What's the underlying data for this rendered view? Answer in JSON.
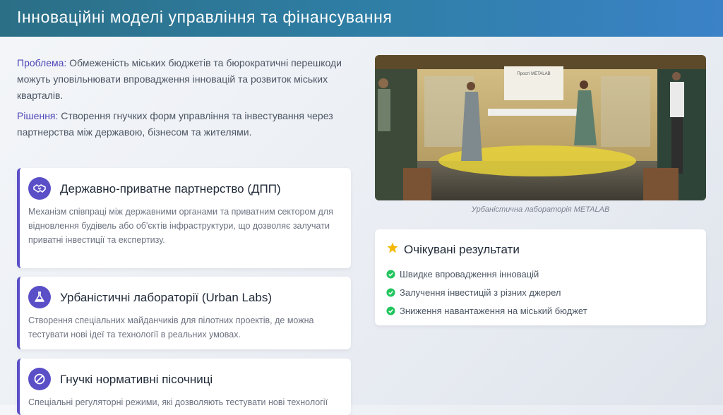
{
  "header": {
    "title": "Інноваційні моделі управління та фінансування"
  },
  "intro": {
    "problem_label": "Проблема:",
    "problem_text": " Обмеженість міських бюджетів та бюрократичні перешкоди можуть уповільнювати впровадження інновацій та розвиток міських кварталів.",
    "solution_label": "Рішення:",
    "solution_text": " Створення гнучких форм управління та інвестування через партнерства між державою, бізнесом та жителями."
  },
  "cards": [
    {
      "icon": "handshake-icon",
      "title": "Державно-приватне партнерство (ДПП)",
      "desc": "Механізм співпраці між державними органами та приватним сектором для відновлення будівель або об'єктів інфраструктури, що дозволяє залучати приватні інвестиції та експертизу."
    },
    {
      "icon": "flask-icon",
      "title": "Урбаністичні лабораторії (Urban Labs)",
      "desc": "Створення спеціальних майданчиків для пілотних проектів, де можна тестувати нові ідеї та технології в реальних умовах."
    },
    {
      "icon": "ban-icon",
      "title": "Гнучкі нормативні пісочниці",
      "desc": "Спеціальні регуляторні режими, які дозволяють тестувати нові технології"
    }
  ],
  "photo": {
    "caption": "Урбаністична лабораторія METALAB",
    "screen_text": "Прості METALAB"
  },
  "results": {
    "title": "Очікувані результати",
    "items": [
      "Швидке впровадження інновацій",
      "Залучення інвестицій з різних джерел",
      "Зниження навантаження на міський бюджет"
    ]
  },
  "colors": {
    "accent": "#5b4fc7",
    "header": "#2f7fa8",
    "check": "#22c55e",
    "star": "#f5b800"
  }
}
